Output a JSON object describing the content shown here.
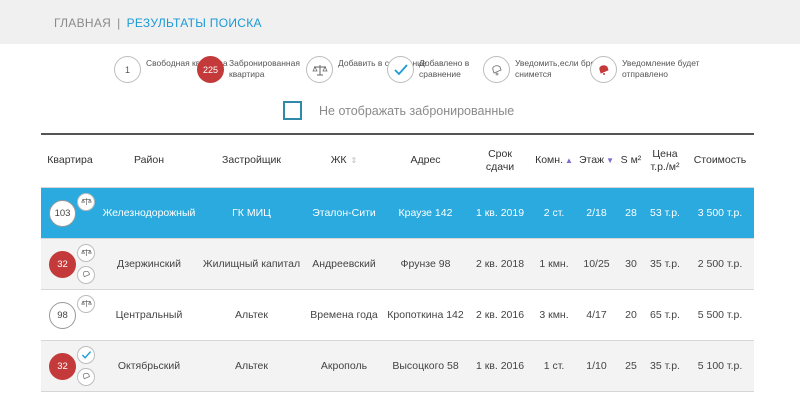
{
  "breadcrumb": {
    "home": "ГЛАВНАЯ",
    "current": "РЕЗУЛЬТАТЫ ПОИСКА"
  },
  "legend": [
    {
      "icon": "free-apartment-icon",
      "badge": "1",
      "label": "Свободная квартира"
    },
    {
      "icon": "booked-apartment-icon",
      "badge": "225",
      "label": "Забронированная квартира"
    },
    {
      "icon": "scales-icon",
      "badge": "",
      "label": "Добавить в сравнение"
    },
    {
      "icon": "checkmark-icon",
      "badge": "",
      "label": "Добавлено в сравнение"
    },
    {
      "icon": "bell-outline-icon",
      "badge": "",
      "label": "Уведомить,если бронь снимется"
    },
    {
      "icon": "bell-filled-icon",
      "badge": "",
      "label": "Уведомление будет отправлено"
    }
  ],
  "filter": {
    "label": "Не отображать забронированные",
    "checked": false
  },
  "table": {
    "headers": {
      "apartment": "Квартира",
      "district": "Район",
      "developer": "Застройщик",
      "complex": "ЖК",
      "address": "Адрес",
      "deadline_1": "Срок",
      "deadline_2": "сдачи",
      "rooms": "Комн.",
      "floor": "Этаж",
      "area": "S м²",
      "price_1": "Цена",
      "price_2": "т.р./м²",
      "cost": "Стоимость"
    },
    "rows": [
      {
        "number": "103",
        "booked": false,
        "district": "Железнодорожный",
        "developer": "ГК МИЦ",
        "complex": "Эталон-Сити",
        "address": "Краузе 142",
        "deadline": "1 кв. 2019",
        "rooms": "2 ст.",
        "floor": "2/18",
        "area": "28",
        "price": "53 т.р.",
        "cost": "3 500 т.р."
      },
      {
        "number": "32",
        "booked": true,
        "district": "Дзержинский",
        "developer": "Жилищный капитал",
        "complex": "Андреевский",
        "address": "Фрунзе 98",
        "deadline": "2 кв. 2018",
        "rooms": "1 кмн.",
        "floor": "10/25",
        "area": "30",
        "price": "35 т.р.",
        "cost": "2 500 т.р."
      },
      {
        "number": "98",
        "booked": false,
        "district": "Центральный",
        "developer": "Альтек",
        "complex": "Времена года",
        "address": "Кропоткина 142",
        "deadline": "2 кв. 2016",
        "rooms": "3 кмн.",
        "floor": "4/17",
        "area": "20",
        "price": "65 т.р.",
        "cost": "5 500 т.р."
      },
      {
        "number": "32",
        "booked": true,
        "district": "Октябрьский",
        "developer": "Альтек",
        "complex": "Акрополь",
        "address": "Высоцкого 58",
        "deadline": "1 кв. 2016",
        "rooms": "1 ст.",
        "floor": "1/10",
        "area": "25",
        "price": "35 т.р.",
        "cost": "5 100 т.р."
      }
    ]
  },
  "colors": {
    "accent": "#1a9ad6",
    "selected_row": "#2aaade",
    "booked": "#c43a3a",
    "checkbox": "#2e8aa8"
  }
}
